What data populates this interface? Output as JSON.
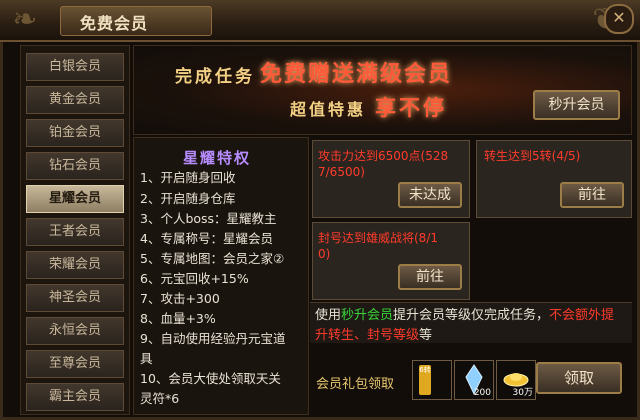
{
  "window": {
    "title": "免费会员",
    "close_icon": "✕"
  },
  "sidebar": {
    "items": [
      {
        "label": "白银会员"
      },
      {
        "label": "黄金会员"
      },
      {
        "label": "铂金会员"
      },
      {
        "label": "钻石会员"
      },
      {
        "label": "星耀会员",
        "active": true
      },
      {
        "label": "王者会员"
      },
      {
        "label": "荣耀会员"
      },
      {
        "label": "神圣会员"
      },
      {
        "label": "永恒会员"
      },
      {
        "label": "至尊会员"
      },
      {
        "label": "霸主会员"
      }
    ]
  },
  "banner": {
    "line1_a": "完成任务",
    "line1_b": "免费赠送满级会员",
    "line2_a": "超值特惠",
    "line2_b": "享不停",
    "instant_upgrade_button": "秒升会员"
  },
  "perks": {
    "title": "星耀特权",
    "items": [
      "1、开启随身回收",
      "2、开启随身仓库",
      "3、个人boss：星耀教主",
      "4、专属称号：星耀会员",
      "5、专属地图：会员之家②",
      "6、元宝回收+15%",
      "7、攻击+300",
      "8、血量+3%",
      "9、自动使用经验丹元宝道",
      "具",
      "10、会员大使处领取天关",
      "灵符*6"
    ]
  },
  "tasks": [
    {
      "text_line1": "攻击力达到6500点(528",
      "text_line2": "7/6500)",
      "button": "未达成"
    },
    {
      "text_line1": "转生达到5转(4/5)",
      "text_line2": "",
      "button": "前往"
    },
    {
      "text_line1": "封号达到雄威战将(8/1",
      "text_line2": "0)",
      "button": "前往"
    }
  ],
  "info": {
    "line1_pre": "使用",
    "line1_green": "秒升会员",
    "line1_mid": "提升会员等级仅完成任务，",
    "line1_red": "不会额外提",
    "line2_red": "升转生、封号等级",
    "line2_post": "等"
  },
  "gift": {
    "label": "会员礼包领取",
    "items": [
      {
        "icon": "scroll-icon",
        "count": "",
        "badge": "6转"
      },
      {
        "icon": "crystal-icon",
        "count": "200"
      },
      {
        "icon": "gold-ingot-icon",
        "count": "30万"
      }
    ],
    "claim_button": "领取"
  }
}
